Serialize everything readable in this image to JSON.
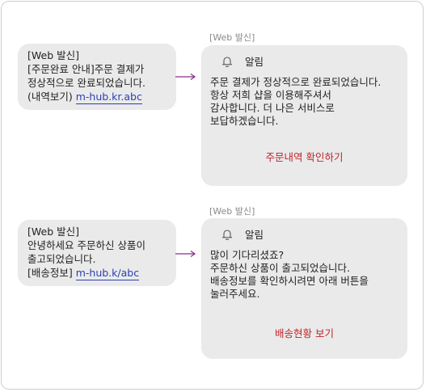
{
  "conversations": [
    {
      "sms": {
        "lines": [
          "[Web 발신]",
          "[주문완료 안내]주문 결제가",
          "정상적으로 완료되었습니다."
        ],
        "link_prefix": "(내역보기) ",
        "link_text": "m-hub.kr.abc"
      },
      "tag": "[Web 발신]",
      "card": {
        "title": "알림",
        "body": [
          "주문 결제가 정상적으로 완료되었습니다.",
          "항상 저희 샵을 이용해주셔서",
          "감사합니다. 더 나은 서비스로",
          "보답하겠습니다."
        ],
        "button_label": "주문내역 확인하기"
      }
    },
    {
      "sms": {
        "lines": [
          "[Web 발신]",
          "안녕하세요 주문하신 상품이",
          "출고되었습니다."
        ],
        "link_prefix": "[배송정보] ",
        "link_text": "m-hub.k/abc"
      },
      "tag": "[Web 발신]",
      "card": {
        "title": "알림",
        "body": [
          "많이 기다리셨죠?",
          "주문하신 상품이 출고되었습니다.",
          "배송정보를 확인하시려면 아래 버튼을",
          "눌러주세요."
        ],
        "button_label": "배송현황 보기"
      }
    }
  ],
  "colors": {
    "bubble_bg": "#eaeaea",
    "link": "#2b3fb3",
    "arrow": "#8b2c8b",
    "action_text": "#c0252a",
    "tag_text": "#8a8a8a"
  },
  "icons": {
    "card_icon": "bell-icon",
    "connector": "arrow-right-icon"
  }
}
